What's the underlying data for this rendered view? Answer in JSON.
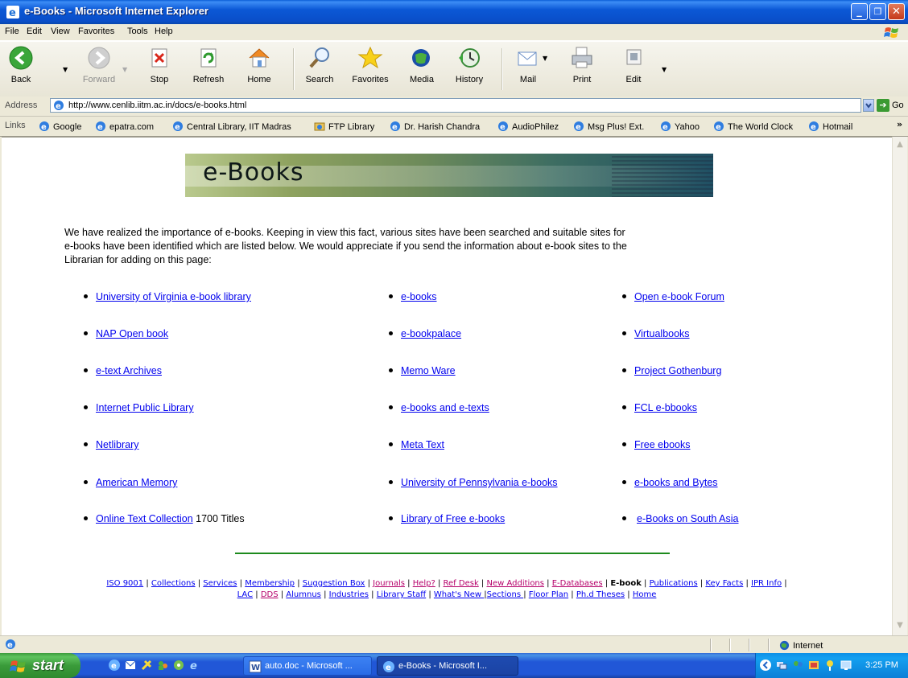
{
  "window": {
    "title": "e-Books - Microsoft Internet Explorer",
    "min_glyph": "_",
    "max_glyph": "❐",
    "close_glyph": "✕"
  },
  "menu": [
    "File",
    "Edit",
    "View",
    "Favorites",
    "Tools",
    "Help"
  ],
  "toolbar": {
    "back": "Back",
    "forward": "Forward",
    "stop": "Stop",
    "refresh": "Refresh",
    "home": "Home",
    "search": "Search",
    "favorites": "Favorites",
    "media": "Media",
    "history": "History",
    "mail": "Mail",
    "print": "Print",
    "edit": "Edit"
  },
  "address": {
    "label": "Address",
    "url": "http://www.cenlib.iitm.ac.in/docs/e-books.html",
    "go": "Go"
  },
  "links_bar": {
    "label": "Links",
    "items": [
      "Google",
      "epatra.com",
      "Central Library, IIT Madras",
      "FTP Library",
      "Dr. Harish Chandra",
      "AudioPhilez",
      "Msg Plus! Ext.",
      "Yahoo",
      "The World Clock",
      "Hotmail"
    ],
    "overflow": "»"
  },
  "page": {
    "banner_title": "e-Books",
    "intro": "We have realized the importance of e-books. Keeping in view this fact, various sites have been searched and suitable sites for e-books have been identified which are listed below. We would appreciate if you send the information about e-book sites to the Librarian for adding on this page:",
    "columns": [
      [
        "University of Virginia e-book library",
        "NAP Open book",
        "e-text Archives",
        "Internet Public Library",
        "Netlibrary",
        "American Memory",
        "Online Text Collection"
      ],
      [
        "e-books",
        "e-bookpalace",
        "Memo Ware",
        "e-books and e-texts",
        "Meta Text",
        "University of Pennsylvania e-books",
        "Library of Free e-books"
      ],
      [
        "Open e-book Forum",
        "Virtualbooks",
        "Project Gothenburg",
        "FCL e-bbooks",
        "Free ebooks",
        "e-books and Bytes",
        "e-Books on South  Asia"
      ]
    ],
    "online_text_suffix": "1700 Titles",
    "footer_line1": [
      "ISO 9001",
      "Collections",
      "Services",
      "Membership",
      "Suggestion Box",
      "Journals",
      "Help?",
      "Ref Desk",
      "New Additions",
      "E-Databases",
      "E-book",
      "Publications",
      "Key Facts",
      "IPR Info"
    ],
    "footer_line2": [
      "LAC",
      "DDS",
      "Alumnus",
      "Industries",
      "Library Staff",
      "What's New ",
      "Sections ",
      "Floor Plan",
      "Ph.d Theses",
      "Home"
    ]
  },
  "status": {
    "zone": "Internet"
  },
  "taskbar": {
    "start": "start",
    "tasks": [
      "auto.doc - Microsoft ...",
      "e-Books - Microsoft I..."
    ],
    "clock": "3:25 PM"
  },
  "colors": {
    "title_blue": "#0a4ec8",
    "link": "#0000ee",
    "visited": "#b5006a",
    "rule_green": "#1d8a1d",
    "start_green": "#3a9b3a"
  }
}
